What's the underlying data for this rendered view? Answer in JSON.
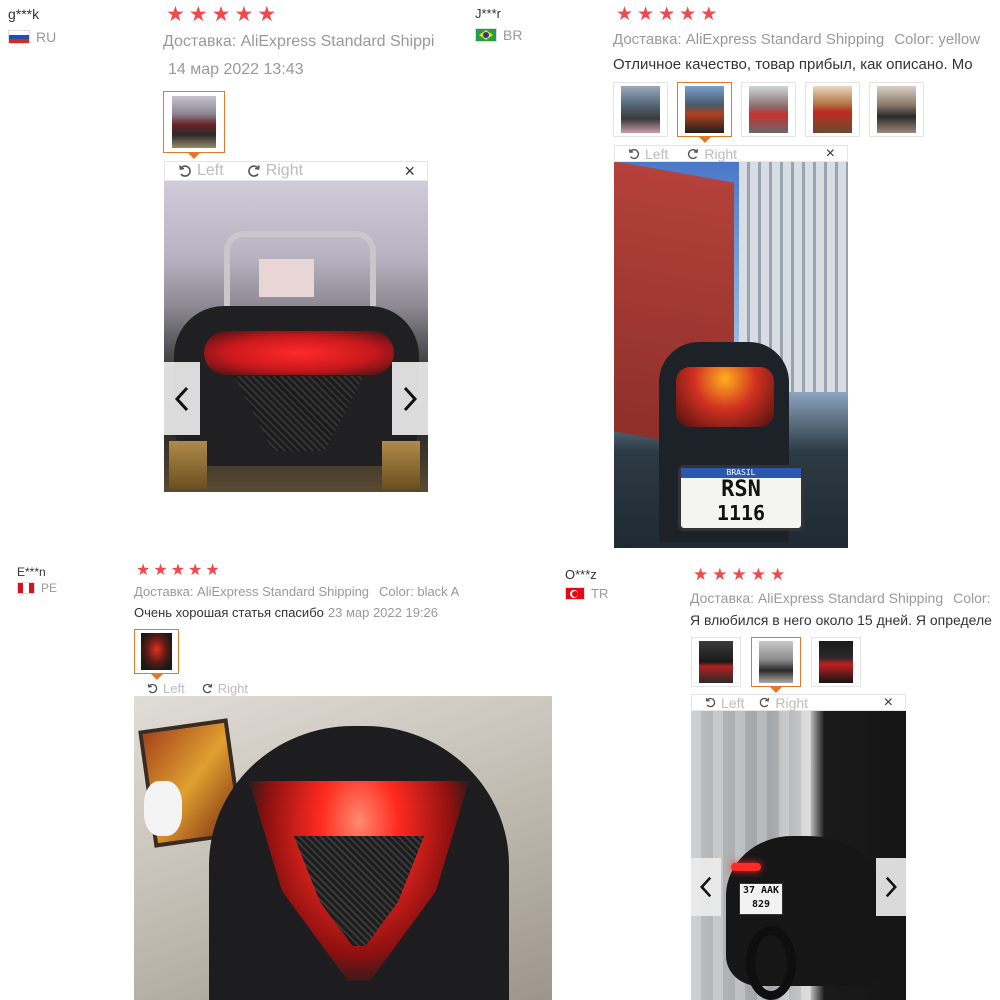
{
  "accent": "#f0494b",
  "active_border": "#e07a2a",
  "rating_star": "★",
  "reviews": [
    {
      "user": "g***k",
      "country": "RU",
      "shipping": "Доставка: AliExpress Standard Shippi",
      "date": "14 мар 2022 13:43",
      "toolbar": {
        "left": "Left",
        "right": "Right",
        "close": "×"
      }
    },
    {
      "user": "J***r",
      "country": "BR",
      "shipping": "Доставка: AliExpress Standard Shipping",
      "color": "Color: yellow",
      "text": "Отличное качество, товар прибыл, как описано. Mo",
      "plate_country": "BRASIL",
      "plate_line1": "RSN",
      "plate_line2": "1116",
      "toolbar": {
        "left": "Left",
        "right": "Right",
        "close": "×"
      }
    },
    {
      "user": "E***n",
      "country": "PE",
      "shipping": "Доставка: AliExpress Standard Shipping",
      "color": "Color: black A",
      "text": "Очень хорошая статья спасибо",
      "date": "23 мар 2022 19:26",
      "toolbar": {
        "left": "Left",
        "right": "Right"
      }
    },
    {
      "user": "O***z",
      "country": "TR",
      "shipping": "Доставка: AliExpress Standard Shipping",
      "color": "Color:",
      "text": "Я влюбился в него около 15 дней. Я определе",
      "plate_line1": "37 AAK",
      "plate_line2": "829",
      "toolbar": {
        "left": "Left",
        "right": "Right",
        "close": "×"
      }
    }
  ]
}
